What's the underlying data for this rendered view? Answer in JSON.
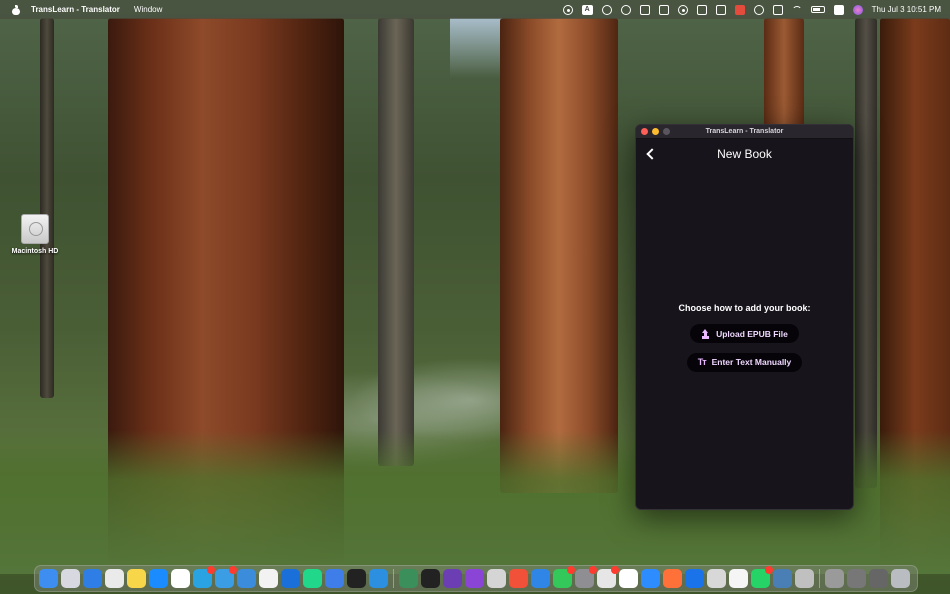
{
  "menubar": {
    "app_name": "TransLearn - Translator",
    "menus": [
      "Window"
    ],
    "status_icons": [
      "chat-icon",
      "keyboard-input-icon",
      "search-icon",
      "night-shift-icon",
      "cat-icon",
      "download-icon",
      "play-icon",
      "screen-share-icon",
      "cursor-icon",
      "record-icon",
      "notification-icon",
      "bluetooth-icon",
      "wifi-icon",
      "battery-icon",
      "control-center-icon",
      "siri-icon"
    ],
    "keyboard_indicator": "A",
    "clock": "Thu Jul 3   10:51 PM"
  },
  "desktop": {
    "icons": [
      {
        "label": "Macintosh HD",
        "icon": "hard-drive-icon"
      }
    ]
  },
  "window": {
    "title": "TransLearn - Translator",
    "page_title": "New Book",
    "prompt": "Choose how to add your book:",
    "upload_label": "Upload EPUB File",
    "manual_label": "Enter Text Manually",
    "manual_icon_glyph": "Tт",
    "accent": "#e9b8ff",
    "background": "#18141c"
  },
  "dock": {
    "apps": [
      {
        "name": "finder",
        "color": "#3d8ef0"
      },
      {
        "name": "launchpad",
        "color": "#d8d8e0"
      },
      {
        "name": "safari",
        "color": "#2f7ee6"
      },
      {
        "name": "chrome",
        "color": "#eaeaea"
      },
      {
        "name": "notes",
        "color": "#f7d64a"
      },
      {
        "name": "app-store",
        "color": "#1a8cff"
      },
      {
        "name": "calendar",
        "color": "#ffffff"
      },
      {
        "name": "telegram",
        "color": "#2aa3e3",
        "badge": true
      },
      {
        "name": "telegram-desktop",
        "color": "#3b9de3",
        "badge": true
      },
      {
        "name": "xcode",
        "color": "#3b8cdb"
      },
      {
        "name": "chatgpt",
        "color": "#f2f2f2"
      },
      {
        "name": "trello",
        "color": "#1a6fd8"
      },
      {
        "name": "pycharm",
        "color": "#21d789"
      },
      {
        "name": "maps",
        "color": "#3f7de8"
      },
      {
        "name": "unity",
        "color": "#222222"
      },
      {
        "name": "vscode",
        "color": "#2c8fe0"
      },
      {
        "name": "sep"
      },
      {
        "name": "cursor",
        "color": "#3a8f5a"
      },
      {
        "name": "terminal",
        "color": "#222222"
      },
      {
        "name": "tor",
        "color": "#6b3fb3"
      },
      {
        "name": "podcasts",
        "color": "#8b45d6"
      },
      {
        "name": "pencil",
        "color": "#d5d5d5"
      },
      {
        "name": "swift",
        "color": "#f05138"
      },
      {
        "name": "preview",
        "color": "#2f86e6"
      },
      {
        "name": "messages",
        "color": "#34c759",
        "badge": true
      },
      {
        "name": "settings",
        "color": "#8e8e93",
        "badge": true
      },
      {
        "name": "slack",
        "color": "#e6e6e6",
        "badge": true
      },
      {
        "name": "yandex",
        "color": "#ffffff"
      },
      {
        "name": "zoom",
        "color": "#2d8cff"
      },
      {
        "name": "firefox",
        "color": "#ff7139"
      },
      {
        "name": "1password",
        "color": "#1a73e8"
      },
      {
        "name": "disk-utility",
        "color": "#d8d8d8"
      },
      {
        "name": "textedit",
        "color": "#f5f5f5"
      },
      {
        "name": "whatsapp",
        "color": "#25d366",
        "badge": true
      },
      {
        "name": "quicktime",
        "color": "#4a7fb5"
      },
      {
        "name": "keka",
        "color": "#c0c0c0"
      },
      {
        "name": "sep"
      },
      {
        "name": "downloads-stack",
        "color": "#9a9a9a"
      },
      {
        "name": "screenshots-stack",
        "color": "#777777"
      },
      {
        "name": "documents-stack",
        "color": "#666666"
      },
      {
        "name": "trash",
        "color": "#b9bcc0"
      }
    ]
  }
}
